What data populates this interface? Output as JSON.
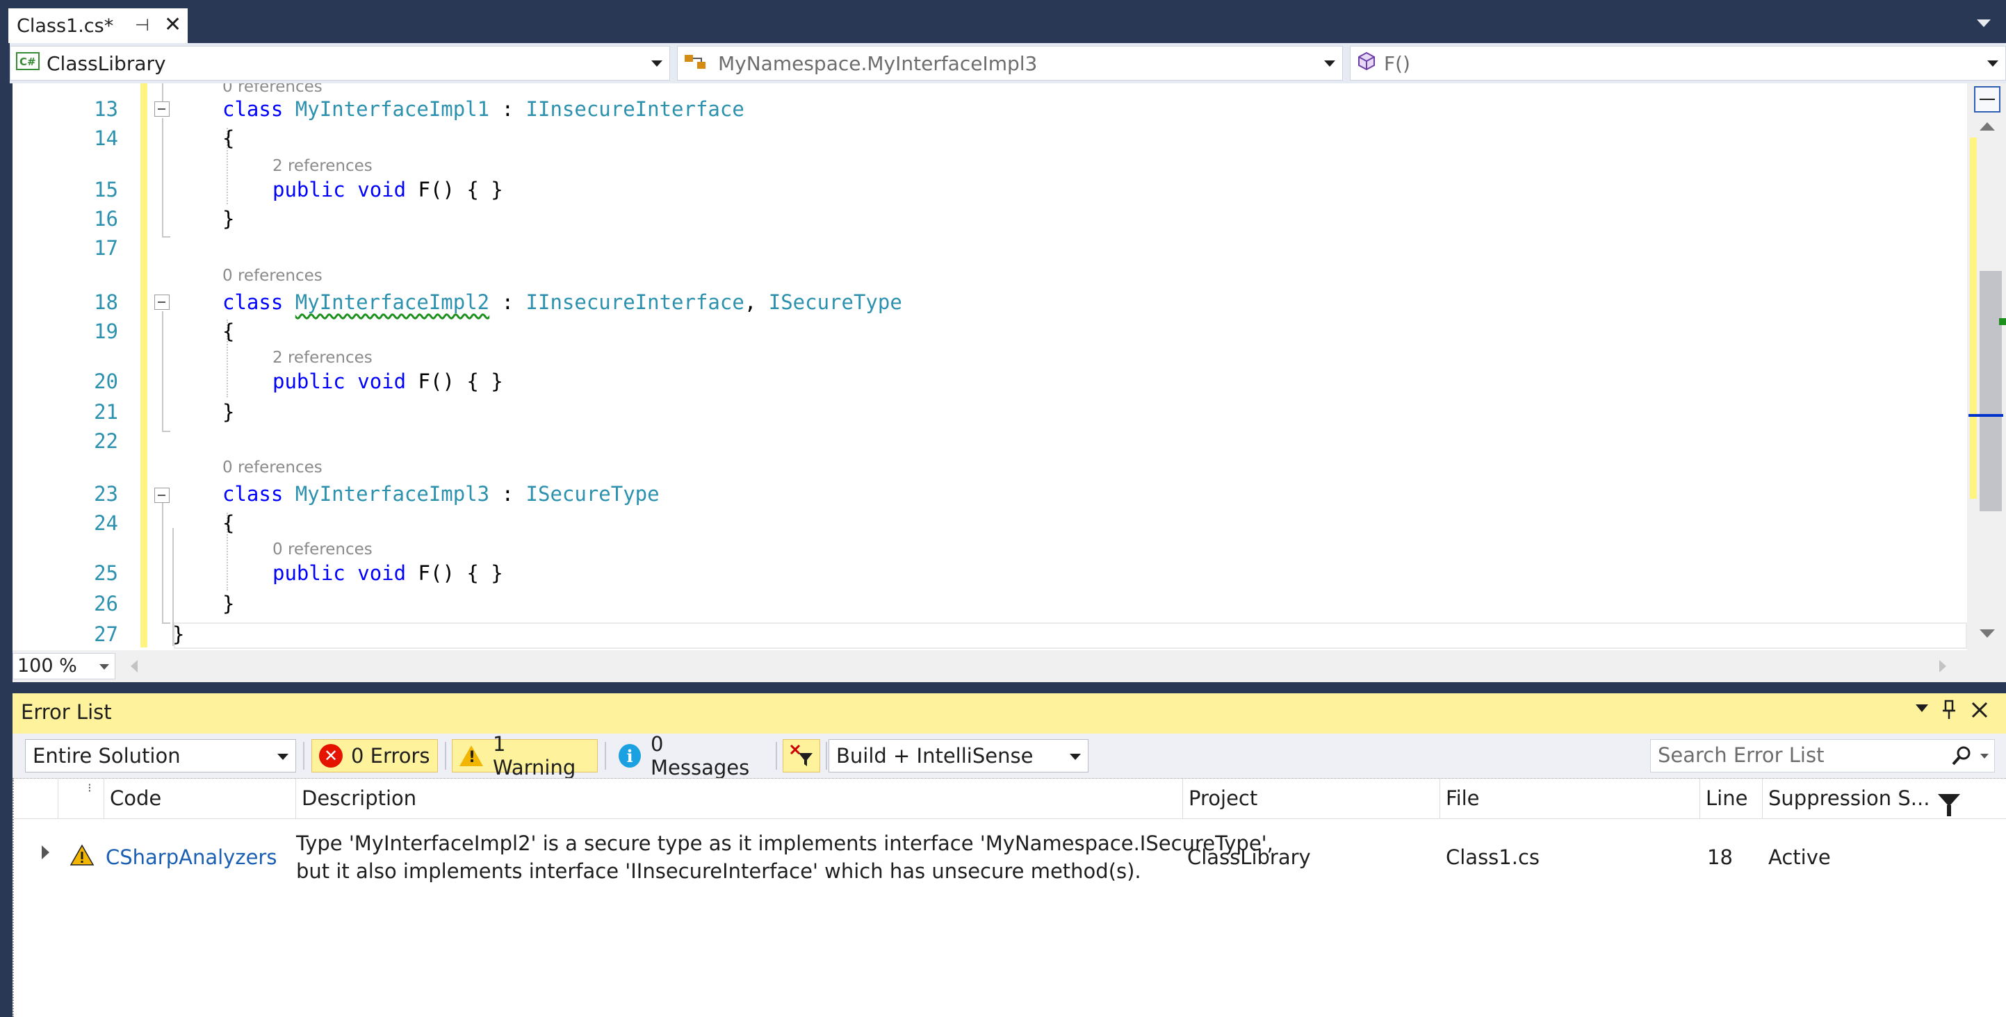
{
  "tab": {
    "title": "Class1.cs*",
    "pin_glyph": "⊣",
    "close_glyph": "✕"
  },
  "nav": {
    "project": "ClassLibrary",
    "type": "MyNamespace.MyInterfaceImpl3",
    "member": "F()"
  },
  "editor": {
    "lens_top_cut": "0 references",
    "lines": [
      {
        "n": "13",
        "lens": "",
        "kw": "class",
        "name": "MyInterfaceImpl1",
        "sep": " : ",
        "bases": "IInsecureInterface"
      },
      {
        "n": "14",
        "text": "{"
      },
      {
        "n": "15",
        "lens": "2 references",
        "text": "public void F() { }"
      },
      {
        "n": "16",
        "text": "}"
      },
      {
        "n": "17",
        "text": ""
      },
      {
        "n": "18",
        "lens": "0 references",
        "kw": "class",
        "name": "MyInterfaceImpl2",
        "sep": " : ",
        "bases": "IInsecureInterface",
        "comma": ", ",
        "bases2": "ISecureType"
      },
      {
        "n": "19",
        "text": "{"
      },
      {
        "n": "20",
        "lens": "2 references",
        "text": "public void F() { }"
      },
      {
        "n": "21",
        "text": "}"
      },
      {
        "n": "22",
        "text": ""
      },
      {
        "n": "23",
        "lens": "0 references",
        "kw": "class",
        "name": "MyInterfaceImpl3",
        "sep": " : ",
        "bases": "ISecureType"
      },
      {
        "n": "24",
        "text": "{"
      },
      {
        "n": "25",
        "lens": "0 references",
        "text": "public void F() { }"
      },
      {
        "n": "26",
        "text": "}"
      },
      {
        "n": "27",
        "text": "}"
      }
    ],
    "kw_public": "public",
    "kw_void": "void",
    "method_tail": "F() { }",
    "zoom": "100 %"
  },
  "error_list": {
    "title": "Error List",
    "scope": "Entire Solution",
    "errors_label": "0 Errors",
    "warnings_label": "1 Warning",
    "messages_label": "0 Messages",
    "source_filter": "Build + IntelliSense",
    "search_placeholder": "Search Error List",
    "columns": {
      "code": "Code",
      "description": "Description",
      "project": "Project",
      "file": "File",
      "line": "Line",
      "suppression": "Suppression S..."
    },
    "rows": [
      {
        "code": "CSharpAnalyzers",
        "description_line1": "Type 'MyInterfaceImpl2' is a secure type as it implements interface 'MyNamespace.ISecureType',",
        "description_line2": "but it also implements interface 'IInsecureInterface' which has unsecure method(s).",
        "project": "ClassLibrary",
        "file": "Class1.cs",
        "line": "18",
        "suppression": "Active"
      }
    ]
  },
  "colors": {
    "keyword": "#0000ff",
    "type": "#2b91af",
    "linenumber": "#2b91af",
    "modified_bar": "#fff481",
    "error_list_title": "#fff29d",
    "chrome": "#293955"
  }
}
